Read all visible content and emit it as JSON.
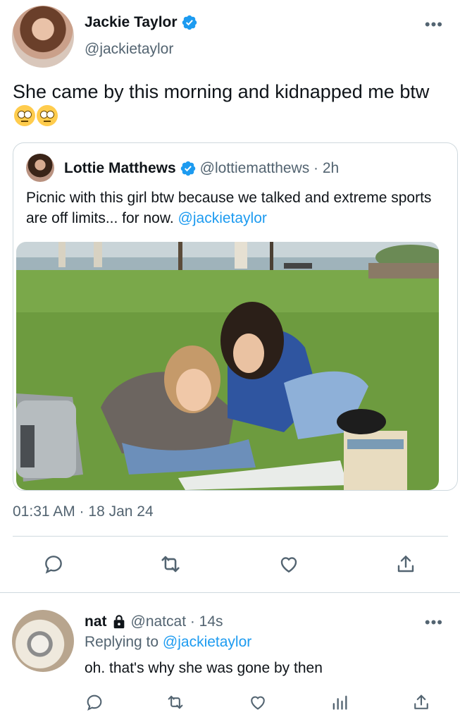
{
  "tweet": {
    "author": {
      "name": "Jackie Taylor",
      "handle": "@jackietaylor",
      "verified": true
    },
    "more_icon": "…",
    "text": "She came by this morning and kidnapped me btw",
    "emojis": [
      "rolling-eyes-emoji",
      "rolling-eyes-emoji"
    ],
    "timestamp": "01:31 AM · 18 Jan 24",
    "actions": [
      {
        "icon": "reply-icon"
      },
      {
        "icon": "retweet-icon"
      },
      {
        "icon": "like-icon"
      },
      {
        "icon": "share-icon"
      }
    ]
  },
  "quote": {
    "author": {
      "name": "Lottie Matthews",
      "handle": "@lottiematthews · 2h",
      "verified": true
    },
    "text": "Picnic with this girl btw because we talked and extreme sports are off limits... for now. ",
    "mention": "@jackietaylor"
  },
  "reply": {
    "author": {
      "name": "nat",
      "handle": "@natcat · 14s",
      "protected": true
    },
    "replying_prefix": "Replying to ",
    "replying_to": "@jackietaylor",
    "text": "oh. that's why she was gone by then",
    "actions": [
      {
        "icon": "reply-icon"
      },
      {
        "icon": "retweet-icon"
      },
      {
        "icon": "like-icon"
      },
      {
        "icon": "analytics-icon"
      },
      {
        "icon": "share-icon"
      }
    ]
  },
  "colors": {
    "link": "#1d9bf0",
    "secondary": "#536471",
    "verified": "#1d9bf0",
    "border": "#cfd9de"
  }
}
